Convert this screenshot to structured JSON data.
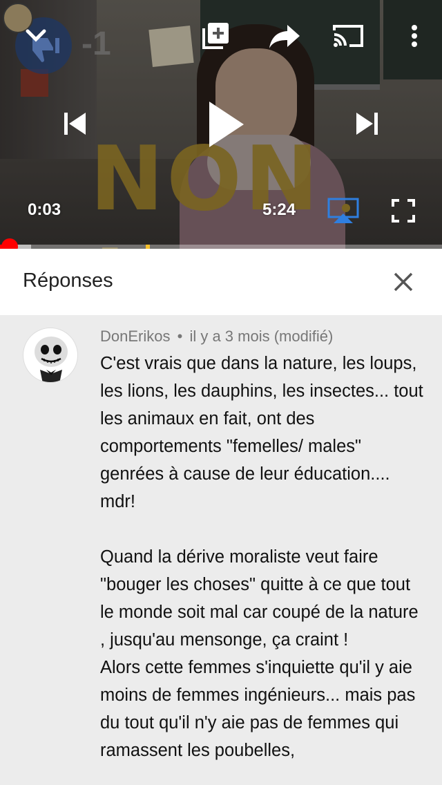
{
  "player": {
    "overlay_text": "NON !",
    "dislike_count": "-1",
    "current_time": "0:03",
    "duration": "5:24",
    "progress_fraction": 0.009,
    "buffered_fraction": 0.07,
    "marker_fraction": 0.33,
    "colors": {
      "played": "#ff0000",
      "marker": "#f7c12d",
      "overlay_text": "#7a6421",
      "cast_active": "#2f7fe0"
    },
    "icons": [
      "chevron-down-icon",
      "add-to-playlist-icon",
      "share-icon",
      "cast-icon",
      "more-vertical-icon",
      "skip-previous-icon",
      "play-icon",
      "skip-next-icon",
      "airplay-icon",
      "fullscreen-icon",
      "thumbs-down-icon"
    ]
  },
  "replies": {
    "title": "Réponses",
    "close_icon": "close-icon"
  },
  "comment": {
    "author": "DonErikos",
    "separator": "•",
    "timestamp": "il y a 3 mois (modifié)",
    "text": "C'est vrais que dans la nature, les loups, les lions, les dauphins, les insectes... tout les animaux en fait, ont des comportements \"femelles/ males\" genrées à cause de leur éducation.... mdr!\n\nQuand la dérive moraliste veut faire \"bouger les choses\" quitte à ce que tout le monde soit mal car coupé de la nature , jusqu'au mensonge, ça craint !\nAlors cette femmes s'inquiette qu'il y aie moins de femmes ingénieurs... mais pas du tout qu'il n'y aie pas de femmes qui ramassent les poubelles,"
  }
}
